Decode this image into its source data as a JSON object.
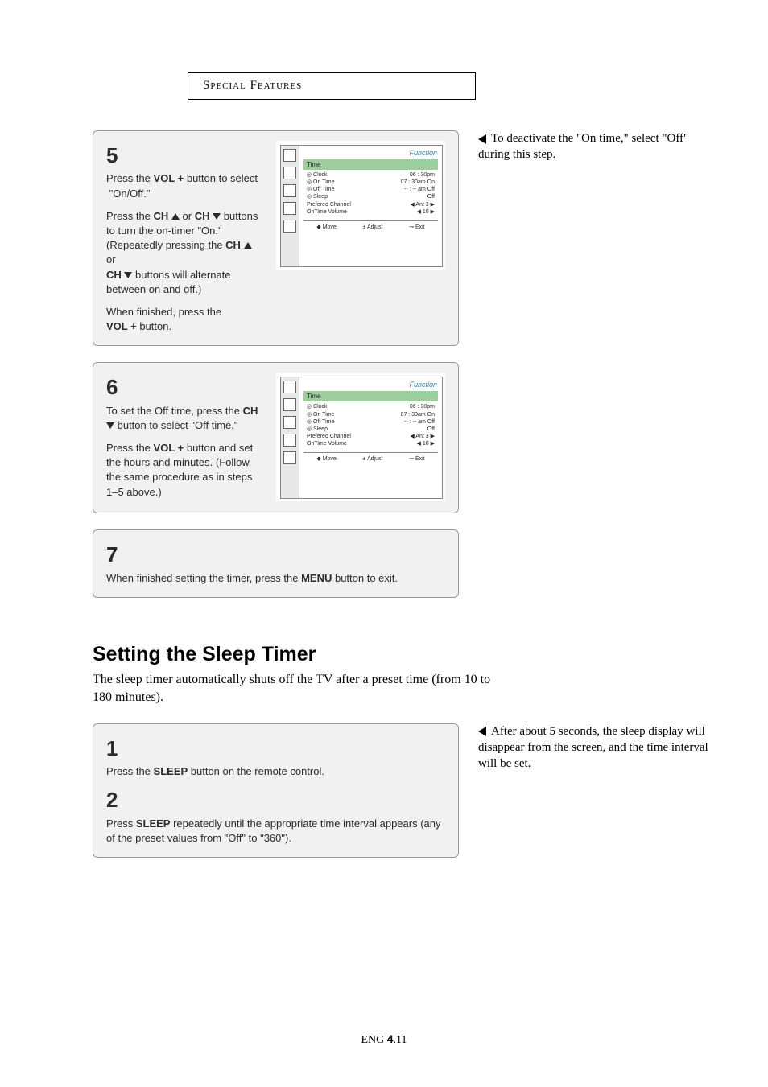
{
  "header": "Special Features",
  "note_right_top": "To deactivate the \"On time,\" select \"Off\" during this step.",
  "step5": {
    "num": "5",
    "p1a": "Press the ",
    "p1b": "VOL +",
    "p1c": " button to select  \"On/Off.\"",
    "p2a": "Press the ",
    "p2b": "CH",
    "p2c": " or ",
    "p2d": "CH",
    "p2e": " buttons to turn the on-timer \"On.\" (Repeatedly pressing the ",
    "p2f": "CH",
    "p2g": " or ",
    "p2h": "CH",
    "p2i": " buttons will alternate between on and off.)",
    "p3a": "When finished, press the ",
    "p3b": "VOL +",
    "p3c": " button."
  },
  "step6": {
    "num": "6",
    "p1a": "To set the Off time, press the ",
    "p1b": "CH",
    "p1c": " button to select \"Off time.\"",
    "p2a": "Press the ",
    "p2b": "VOL +",
    "p2c": " button and set the hours and minutes. (Follow the same procedure as in steps 1–5 above.)"
  },
  "step7": {
    "num": "7",
    "p1a": "When finished setting the timer, press the ",
    "p1b": "MENU",
    "p1c": " button to exit."
  },
  "sleep": {
    "title": "Setting the Sleep Timer",
    "intro": "The sleep timer automatically shuts off the TV after a preset time (from 10 to 180 minutes).",
    "note": "After about 5 seconds, the sleep display will disappear from the screen, and the time interval will be set.",
    "s1num": "1",
    "s1a": "Press the ",
    "s1b": "SLEEP",
    "s1c": " button on the remote control.",
    "s2num": "2",
    "s2a": "Press ",
    "s2b": "SLEEP",
    "s2c": " repeatedly until the appropriate time interval appears (any of the preset values from \"Off\" to \"360\")."
  },
  "footer": {
    "a": "ENG ",
    "b": "4",
    "c": ".11"
  },
  "osd5": {
    "func": "Function",
    "title": "Time",
    "rows": [
      [
        "◎ Clock",
        "06 : 30pm"
      ],
      [
        "◎ On Time",
        "07 : 30am On"
      ],
      [
        "◎ Off Time",
        "-- : -- am  Off"
      ],
      [
        "◎ Sleep",
        "Off"
      ],
      [
        "Prefered Channel",
        "◀ Ant 3 ▶"
      ],
      [
        "OnTime Volume",
        "◀  10  ▶"
      ]
    ],
    "foot": [
      "◆ Move",
      "± Adjust",
      "⊸ Exit"
    ]
  },
  "osd6": {
    "func": "Function",
    "title": "Time",
    "rows": [
      [
        "◎ Clock",
        "06 : 30pm"
      ],
      [
        "◎ On Time",
        "07 : 30am On"
      ],
      [
        "◎ Off Time",
        "-- : -- am  Off"
      ],
      [
        "◎ Sleep",
        "Off"
      ],
      [
        "Prefered Channel",
        "◀ Ant 3 ▶"
      ],
      [
        "OnTime Volume",
        "◀  10  ▶"
      ]
    ],
    "foot": [
      "◆ Move",
      "± Adjust",
      "⊸ Exit"
    ]
  }
}
